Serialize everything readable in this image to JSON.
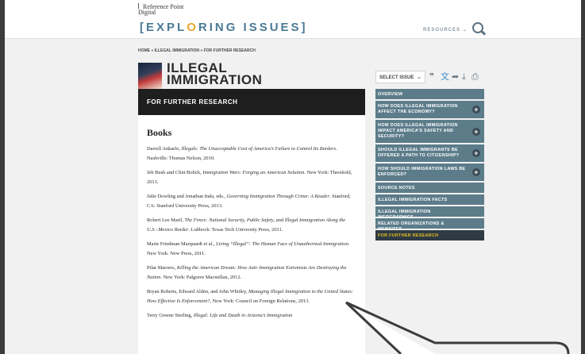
{
  "header": {
    "logo_text": "Reference Point Digital",
    "site_title_a": "[EXPL",
    "site_title_b": "O",
    "site_title_c": "RING ISSUES]",
    "resources_label": "RESOURCES ⌄"
  },
  "breadcrumb": "HOME » ILLEGAL IMMIGRATION » FOR FURTHER RESEARCH",
  "issue": {
    "title_line1": "ILLEGAL",
    "title_line2": "IMMIGRATION"
  },
  "select_issue": {
    "label": "SELECT ISSUE",
    "chevron": "⌄"
  },
  "tools": {
    "quote": "❞",
    "translate": "文",
    "share": "➦",
    "download": "⤓",
    "print": "⎙"
  },
  "content": {
    "section_title": "FOR FURTHER RESEARCH",
    "books_heading": "Books",
    "entries": [
      {
        "pre": "Darrell Ankarlo, ",
        "title": "Illegals: The Unacceptable Cost of America’s Failure to Control Its Borders",
        "post": ". Nashville: Thomas Nelson, 2010."
      },
      {
        "pre": "Jeb Bush and Clint Bolick, ",
        "title": "Immigration Wars: Forging an American Solution",
        "post": ". New York: Threshold, 2013."
      },
      {
        "pre": "Julie Dowling and Jonathan Inda, eds., ",
        "title": "Governing Immigration Through Crime: A Reader",
        "post": ". Stanford, CA: Stanford University Press, 2013."
      },
      {
        "pre": "Robert Lee Maril, ",
        "title": "The Fence: National Security, Public Safety, and Illegal Immigration Along the U.S.–Mexico Border",
        "post": ". Lubbock: Texas Tech University Press, 2011."
      },
      {
        "pre": "Marie Friedman Marquardt et al., ",
        "title": "Living “Illegal”: The Human Face of Unauthorized Immigration",
        "post": ". New York: New Press, 2011."
      },
      {
        "pre": "Pilar Marrero, ",
        "title": "Killing the American Dream: How Anti–Immigration Extremists Are Destroying the Nation",
        "post": ". New York: Palgrave Macmillan, 2012."
      },
      {
        "pre": "Bryan Roberts, Edward Alden, and John Whitley, ",
        "title": "Managing Illegal Immigration to the United States: How Effective Is Enforcement?",
        "post": ", New York: Council on Foreign Relations, 2013."
      },
      {
        "pre": "Terry Greene Sterling, ",
        "title": "Illegal: Life and Death in Arizona’s Immigration",
        "post": ""
      }
    ]
  },
  "sidebar": {
    "items": [
      {
        "label": "OVERVIEW",
        "plus": false,
        "active": false
      },
      {
        "label": "HOW DOES ILLEGAL IMMIGRATION AFFECT THE ECONOMY?",
        "plus": true,
        "active": false
      },
      {
        "label": "HOW DOES ILLEGAL IMMIGRATION IMPACT AMERICA’S SAFETY AND SECURITY?",
        "plus": true,
        "active": false
      },
      {
        "label": "SHOULD ILLEGAL IMMIGRANTS BE OFFERED A PATH TO CITIZENSHIP?",
        "plus": true,
        "active": false
      },
      {
        "label": "HOW SHOULD IMMIGRATION LAWS BE ENFORCED?",
        "plus": true,
        "active": false
      },
      {
        "label": "SOURCE NOTES",
        "plus": false,
        "active": false
      },
      {
        "label": "ILLEGAL IMMIGRATION FACTS",
        "plus": false,
        "active": false
      },
      {
        "label": "ILLEGAL IMMIGRATION INFOGRAPHICS",
        "plus": false,
        "active": false
      },
      {
        "label": "RELATED ORGANIZATIONS & WEBSITES",
        "plus": false,
        "active": false
      },
      {
        "label": "FOR FURTHER RESEARCH",
        "plus": false,
        "active": true
      }
    ]
  },
  "colors": {
    "accent": "#e8a72c",
    "title_blue": "#4a7a95",
    "sidebar_bg": "#5c7c8a",
    "sidebar_active_bg": "#2e3a44",
    "sidebar_active_text": "#e5c01f"
  }
}
